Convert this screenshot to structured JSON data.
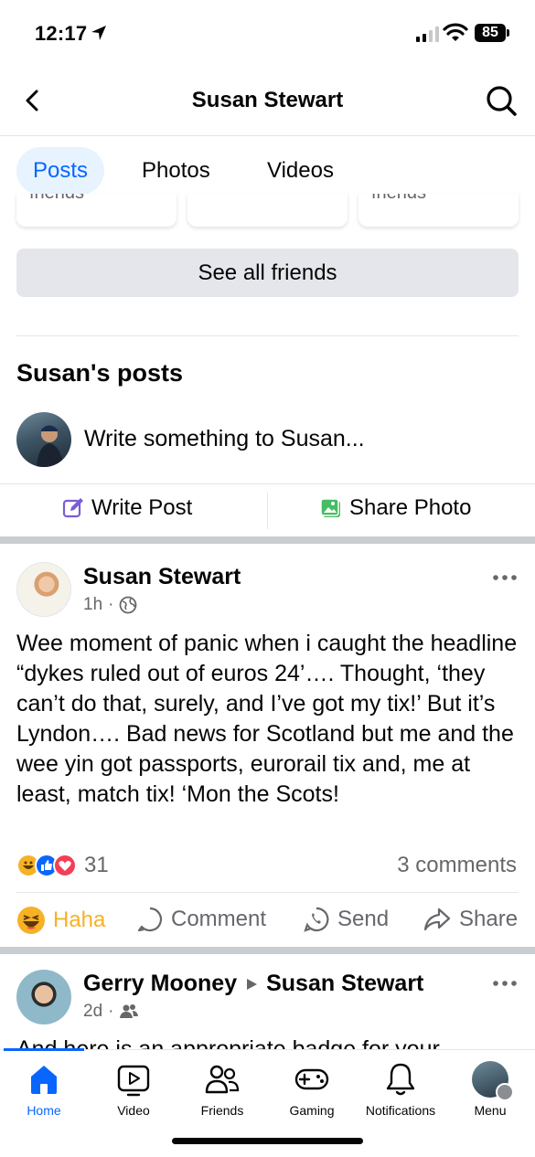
{
  "status_bar": {
    "time": "12:17",
    "battery": "85"
  },
  "header": {
    "title": "Susan Stewart"
  },
  "tabs": [
    {
      "label": "Posts",
      "active": true
    },
    {
      "label": "Photos",
      "active": false
    },
    {
      "label": "Videos",
      "active": false
    }
  ],
  "friends_section": {
    "card_peek_texts": [
      "friends",
      "",
      "friends"
    ],
    "see_all_label": "See all friends"
  },
  "posts_section": {
    "heading": "Susan's posts",
    "composer_placeholder": "Write something to Susan...",
    "write_post_label": "Write Post",
    "share_photo_label": "Share Photo"
  },
  "post1": {
    "author": "Susan Stewart",
    "time": "1h",
    "audience_icon": "globe-icon",
    "body": "Wee moment of panic when i caught the headline “dykes ruled out of euros 24’…. Thought, ‘they can’t do that, surely, and I’ve got my tix!’ But it’s Lyndon…. Bad news for Scotland but me and the wee yin got passports, eurorail tix and, me at least, match tix! ‘Mon the Scots!",
    "reaction_count": "31",
    "comments": "3 comments",
    "actions": {
      "reaction": "Haha",
      "comment": "Comment",
      "send": "Send",
      "share": "Share"
    }
  },
  "post2": {
    "author": "Gerry Mooney",
    "target": "Susan Stewart",
    "time": "2d",
    "audience_icon": "friends-icon",
    "body_partial": "And here is an appropriate badge for your"
  },
  "tabbar": [
    {
      "label": "Home",
      "icon": "home-icon",
      "active": true
    },
    {
      "label": "Video",
      "icon": "video-icon",
      "active": false
    },
    {
      "label": "Friends",
      "icon": "friends-icon",
      "active": false
    },
    {
      "label": "Gaming",
      "icon": "gaming-icon",
      "active": false
    },
    {
      "label": "Notifications",
      "icon": "bell-icon",
      "active": false
    },
    {
      "label": "Menu",
      "icon": "avatar",
      "active": false
    }
  ],
  "colors": {
    "accent": "#0866ff",
    "haha": "#f7b125",
    "secondary_text": "#65676b"
  }
}
